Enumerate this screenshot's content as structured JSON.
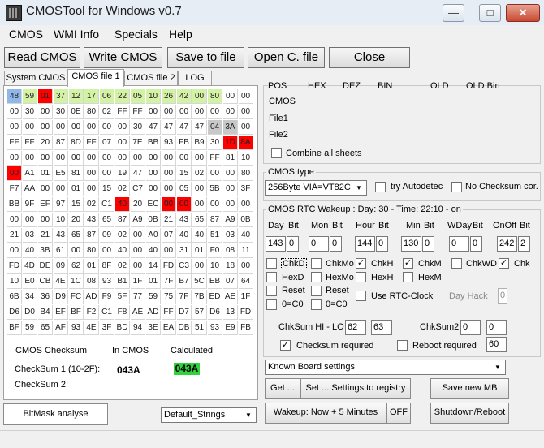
{
  "window": {
    "title": "CMOSTool for Windows v0.7",
    "minimize": "—",
    "maximize": "□",
    "close": "✕"
  },
  "menu": [
    "CMOS",
    "WMI Info",
    "Specials",
    "Help"
  ],
  "toolbar": {
    "read": "Read CMOS",
    "write": "Write CMOS",
    "save": "Save to file",
    "open": "Open C. file",
    "close": "Close"
  },
  "tabs": [
    "System CMOS",
    "CMOS file 1",
    "CMOS file 2",
    "LOG"
  ],
  "active_tab": 1,
  "colors": {
    "light_blue": "#8fb7e8",
    "green": "#d3f2a5",
    "red": "#ff0000",
    "grey": "#c8c8c8"
  },
  "grid": [
    [
      "48",
      "59",
      "01",
      "37",
      "12",
      "17",
      "06",
      "22",
      "05",
      "10",
      "26",
      "42",
      "00",
      "80",
      "00",
      "00"
    ],
    [
      "00",
      "30",
      "00",
      "30",
      "0E",
      "80",
      "02",
      "FF",
      "FF",
      "00",
      "00",
      "00",
      "00",
      "00",
      "00",
      "00"
    ],
    [
      "00",
      "00",
      "00",
      "00",
      "00",
      "00",
      "00",
      "00",
      "30",
      "47",
      "47",
      "47",
      "47",
      "04",
      "3A",
      "00"
    ],
    [
      "FF",
      "FF",
      "20",
      "87",
      "8D",
      "FF",
      "07",
      "00",
      "7E",
      "BB",
      "93",
      "FB",
      "B9",
      "30",
      "1D",
      "8A"
    ],
    [
      "00",
      "00",
      "00",
      "00",
      "00",
      "00",
      "00",
      "00",
      "00",
      "00",
      "00",
      "00",
      "00",
      "FF",
      "81",
      "10"
    ],
    [
      "00",
      "A1",
      "01",
      "E5",
      "81",
      "00",
      "00",
      "19",
      "47",
      "00",
      "00",
      "15",
      "02",
      "00",
      "00",
      "80"
    ],
    [
      "F7",
      "AA",
      "00",
      "00",
      "01",
      "00",
      "15",
      "02",
      "C7",
      "00",
      "00",
      "05",
      "00",
      "5B",
      "00",
      "3F"
    ],
    [
      "BB",
      "9F",
      "EF",
      "97",
      "15",
      "02",
      "C1",
      "40",
      "20",
      "EC",
      "00",
      "00",
      "00",
      "00",
      "00",
      "00"
    ],
    [
      "00",
      "00",
      "00",
      "10",
      "20",
      "43",
      "65",
      "87",
      "A9",
      "0B",
      "21",
      "43",
      "65",
      "87",
      "A9",
      "0B"
    ],
    [
      "21",
      "03",
      "21",
      "43",
      "65",
      "87",
      "09",
      "02",
      "00",
      "A0",
      "07",
      "40",
      "40",
      "51",
      "03",
      "40"
    ],
    [
      "00",
      "40",
      "3B",
      "61",
      "00",
      "80",
      "00",
      "40",
      "00",
      "40",
      "00",
      "31",
      "01",
      "F0",
      "08",
      "11"
    ],
    [
      "FD",
      "4D",
      "DE",
      "09",
      "62",
      "01",
      "8F",
      "02",
      "00",
      "14",
      "FD",
      "C3",
      "00",
      "10",
      "18",
      "00"
    ],
    [
      "10",
      "E0",
      "CB",
      "4E",
      "1C",
      "08",
      "93",
      "B1",
      "1F",
      "01",
      "7F",
      "B7",
      "5C",
      "EB",
      "07",
      "64"
    ],
    [
      "6B",
      "34",
      "36",
      "D9",
      "FC",
      "AD",
      "F9",
      "5F",
      "77",
      "59",
      "75",
      "7F",
      "7B",
      "ED",
      "AE",
      "1F"
    ],
    [
      "D6",
      "D0",
      "B4",
      "EF",
      "BF",
      "F2",
      "C1",
      "F8",
      "AE",
      "AD",
      "FF",
      "D7",
      "57",
      "D6",
      "13",
      "FD"
    ],
    [
      "BF",
      "59",
      "65",
      "AF",
      "93",
      "4E",
      "3F",
      "BD",
      "94",
      "3E",
      "EA",
      "DB",
      "51",
      "93",
      "E9",
      "FB"
    ]
  ],
  "grid_highlights": [
    {
      "r": 0,
      "c": 0,
      "color": "light_blue"
    },
    {
      "r": 0,
      "c": 1,
      "color": "green"
    },
    {
      "r": 0,
      "c": 2,
      "color": "red"
    },
    {
      "r": 0,
      "c": 3,
      "color": "green"
    },
    {
      "r": 0,
      "c": 4,
      "color": "green"
    },
    {
      "r": 0,
      "c": 5,
      "color": "green"
    },
    {
      "r": 0,
      "c": 6,
      "color": "green"
    },
    {
      "r": 0,
      "c": 7,
      "color": "green"
    },
    {
      "r": 0,
      "c": 8,
      "color": "green"
    },
    {
      "r": 0,
      "c": 9,
      "color": "green"
    },
    {
      "r": 0,
      "c": 10,
      "color": "green"
    },
    {
      "r": 0,
      "c": 11,
      "color": "green"
    },
    {
      "r": 0,
      "c": 12,
      "color": "green"
    },
    {
      "r": 0,
      "c": 13,
      "color": "green"
    },
    {
      "r": 2,
      "c": 13,
      "color": "grey"
    },
    {
      "r": 2,
      "c": 14,
      "color": "grey"
    },
    {
      "r": 3,
      "c": 14,
      "color": "red"
    },
    {
      "r": 3,
      "c": 15,
      "color": "red"
    },
    {
      "r": 5,
      "c": 0,
      "color": "red"
    },
    {
      "r": 7,
      "c": 7,
      "color": "red"
    },
    {
      "r": 7,
      "c": 10,
      "color": "red"
    },
    {
      "r": 7,
      "c": 11,
      "color": "red"
    }
  ],
  "checksum": {
    "title": "CMOS Checksum",
    "in_cmos": "In CMOS",
    "calculated": "Calculated",
    "row1_label": "CheckSum 1 (10-2F):",
    "row1_cmos": "043A",
    "row1_calc": "043A",
    "row2_label": "CheckSum 2:"
  },
  "bitmask_button": "BitMask analyse",
  "strings_combo": "Default_Strings",
  "pos": {
    "headers": [
      "POS",
      "HEX",
      "DEZ",
      "BIN",
      "OLD",
      "OLD Bin"
    ],
    "rows": [
      "CMOS",
      "File1",
      "File2"
    ],
    "combine": "Combine all sheets"
  },
  "cmos_type": {
    "title": "CMOS type",
    "value": "256Byte VIA=VT82C",
    "autodetect": "try Autodetec",
    "no_checksum": "No Checksum cor."
  },
  "wakeup": {
    "title": "CMOS RTC Wakeup : Day: 30 - Time: 22:10 - on",
    "columns": [
      "Day",
      "Bit",
      "Mon",
      "Bit",
      "Hour",
      "Bit",
      "Min",
      "Bit",
      "WDay",
      "Bit",
      "OnOff",
      "Bit"
    ],
    "values": [
      "143",
      "0",
      "0",
      "0",
      "144",
      "0",
      "130",
      "0",
      "0",
      "0",
      "242",
      "2"
    ],
    "chk_row": [
      {
        "label": "ChkD",
        "checked": false
      },
      {
        "label": "ChkMo",
        "checked": false
      },
      {
        "label": "ChkH",
        "checked": true
      },
      {
        "label": "ChkM",
        "checked": true
      },
      {
        "label": "ChkWD",
        "checked": false
      },
      {
        "label": "Chk",
        "checked": true
      }
    ],
    "hex_row": [
      "HexD",
      "HexMo",
      "HexH",
      "HexM"
    ],
    "reset_row": [
      "Reset",
      "Reset"
    ],
    "zero_row": [
      "0=C0",
      "0=C0"
    ],
    "use_rtc": "Use RTC-Clock",
    "day_hack": "Day Hack",
    "day_hack_value": "0",
    "chksum_hilo": "ChkSum HI - LO",
    "hi": "62",
    "lo": "63",
    "chksum2": "ChkSum2",
    "cs2a": "0",
    "cs2b": "0",
    "checksum_required": "Checksum required",
    "reboot_required": "Reboot required",
    "reboot_value": "60"
  },
  "known_board": "Known Board settings",
  "get_button": "Get ...",
  "settings_registry": "Set ... Settings to registry",
  "save_mb": "Save new MB",
  "wakeup_btn": "Wakeup: Now + 5 Minutes",
  "off_btn": "OFF",
  "shutdown_btn": "Shutdown/Reboot"
}
